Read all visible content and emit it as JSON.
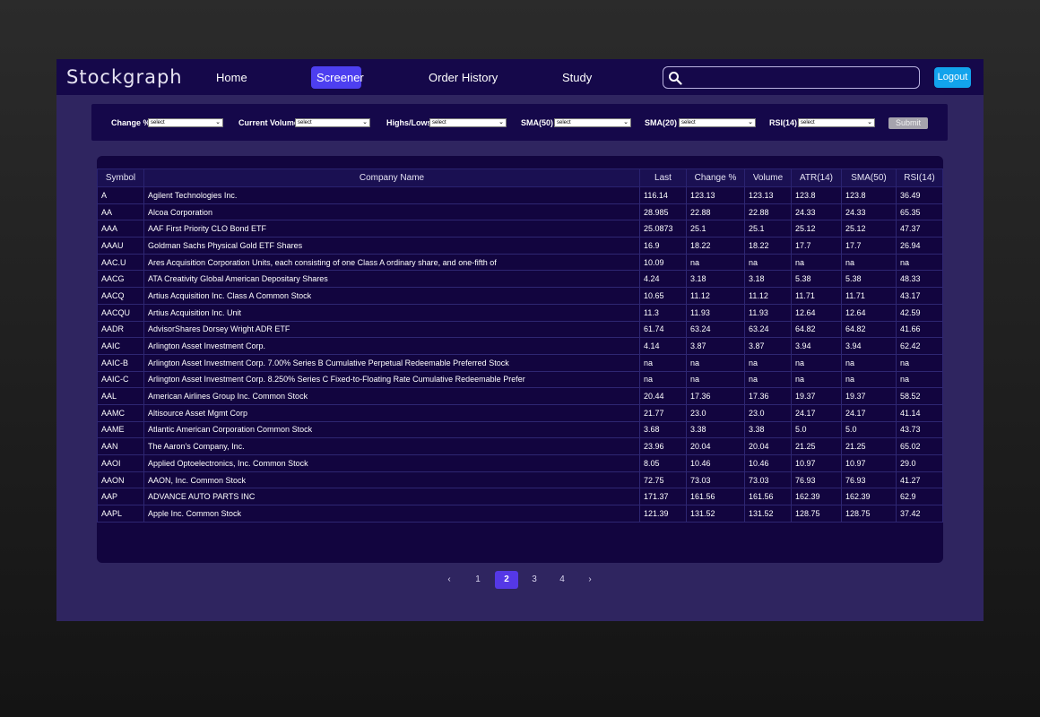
{
  "brand": "Stockgraph",
  "nav": {
    "home": "Home",
    "screener": "Screener",
    "order_history": "Order History",
    "study": "Study",
    "search_placeholder": "",
    "logout": "Logout"
  },
  "filters": {
    "change_pct": {
      "label": "Change %",
      "value": "select"
    },
    "current_volume": {
      "label": "Current Volume",
      "value": "select"
    },
    "highs_lows": {
      "label": "Highs/Lows",
      "value": "select"
    },
    "sma50": {
      "label": "SMA(50)",
      "value": "select"
    },
    "sma20": {
      "label": "SMA(20)",
      "value": "select"
    },
    "rsi14": {
      "label": "RSI(14)",
      "value": "select"
    },
    "submit": "Submit"
  },
  "table": {
    "headers": [
      "Symbol",
      "Company Name",
      "Last",
      "Change %",
      "Volume",
      "ATR(14)",
      "SMA(50)",
      "RSI(14)"
    ],
    "rows": [
      [
        "A",
        "Agilent Technologies Inc.",
        "116.14",
        "123.13",
        "123.13",
        "123.8",
        "123.8",
        "36.49"
      ],
      [
        "AA",
        "Alcoa Corporation",
        "28.985",
        "22.88",
        "22.88",
        "24.33",
        "24.33",
        "65.35"
      ],
      [
        "AAA",
        "AAF First Priority CLO Bond ETF",
        "25.0873",
        "25.1",
        "25.1",
        "25.12",
        "25.12",
        "47.37"
      ],
      [
        "AAAU",
        "Goldman Sachs Physical Gold ETF Shares",
        "16.9",
        "18.22",
        "18.22",
        "17.7",
        "17.7",
        "26.94"
      ],
      [
        "AAC.U",
        "Ares Acquisition Corporation Units, each consisting of one Class A ordinary share, and one-fifth of",
        "10.09",
        "na",
        "na",
        "na",
        "na",
        "na"
      ],
      [
        "AACG",
        "ATA Creativity Global American Depositary Shares",
        "4.24",
        "3.18",
        "3.18",
        "5.38",
        "5.38",
        "48.33"
      ],
      [
        "AACQ",
        "Artius Acquisition Inc. Class A Common Stock",
        "10.65",
        "11.12",
        "11.12",
        "11.71",
        "11.71",
        "43.17"
      ],
      [
        "AACQU",
        "Artius Acquisition Inc. Unit",
        "11.3",
        "11.93",
        "11.93",
        "12.64",
        "12.64",
        "42.59"
      ],
      [
        "AADR",
        "AdvisorShares Dorsey Wright ADR ETF",
        "61.74",
        "63.24",
        "63.24",
        "64.82",
        "64.82",
        "41.66"
      ],
      [
        "AAIC",
        "Arlington Asset Investment Corp.",
        "4.14",
        "3.87",
        "3.87",
        "3.94",
        "3.94",
        "62.42"
      ],
      [
        "AAIC-B",
        "Arlington Asset Investment Corp. 7.00% Series B Cumulative Perpetual Redeemable Preferred Stock",
        "na",
        "na",
        "na",
        "na",
        "na",
        "na"
      ],
      [
        "AAIC-C",
        "Arlington Asset Investment Corp. 8.250% Series C Fixed-to-Floating Rate Cumulative Redeemable Prefer",
        "na",
        "na",
        "na",
        "na",
        "na",
        "na"
      ],
      [
        "AAL",
        "American Airlines Group Inc. Common Stock",
        "20.44",
        "17.36",
        "17.36",
        "19.37",
        "19.37",
        "58.52"
      ],
      [
        "AAMC",
        "Altisource Asset Mgmt Corp",
        "21.77",
        "23.0",
        "23.0",
        "24.17",
        "24.17",
        "41.14"
      ],
      [
        "AAME",
        "Atlantic American Corporation Common Stock",
        "3.68",
        "3.38",
        "3.38",
        "5.0",
        "5.0",
        "43.73"
      ],
      [
        "AAN",
        "The Aaron's Company, Inc.",
        "23.96",
        "20.04",
        "20.04",
        "21.25",
        "21.25",
        "65.02"
      ],
      [
        "AAOI",
        "Applied Optoelectronics, Inc. Common Stock",
        "8.05",
        "10.46",
        "10.46",
        "10.97",
        "10.97",
        "29.0"
      ],
      [
        "AAON",
        "AAON, Inc. Common Stock",
        "72.75",
        "73.03",
        "73.03",
        "76.93",
        "76.93",
        "41.27"
      ],
      [
        "AAP",
        "ADVANCE AUTO PARTS INC",
        "171.37",
        "161.56",
        "161.56",
        "162.39",
        "162.39",
        "62.9"
      ],
      [
        "AAPL",
        "Apple Inc. Common Stock",
        "121.39",
        "131.52",
        "131.52",
        "128.75",
        "128.75",
        "37.42"
      ]
    ]
  },
  "pagination": {
    "prev": "‹",
    "pages": [
      "1",
      "2",
      "3",
      "4"
    ],
    "active": "2",
    "next": "›"
  },
  "colors": {
    "navbar": "#15084a",
    "app_bg": "#2f2560",
    "active_nav": "#4d3ff0",
    "logout": "#12a3ec",
    "active_page": "#5538e6"
  }
}
